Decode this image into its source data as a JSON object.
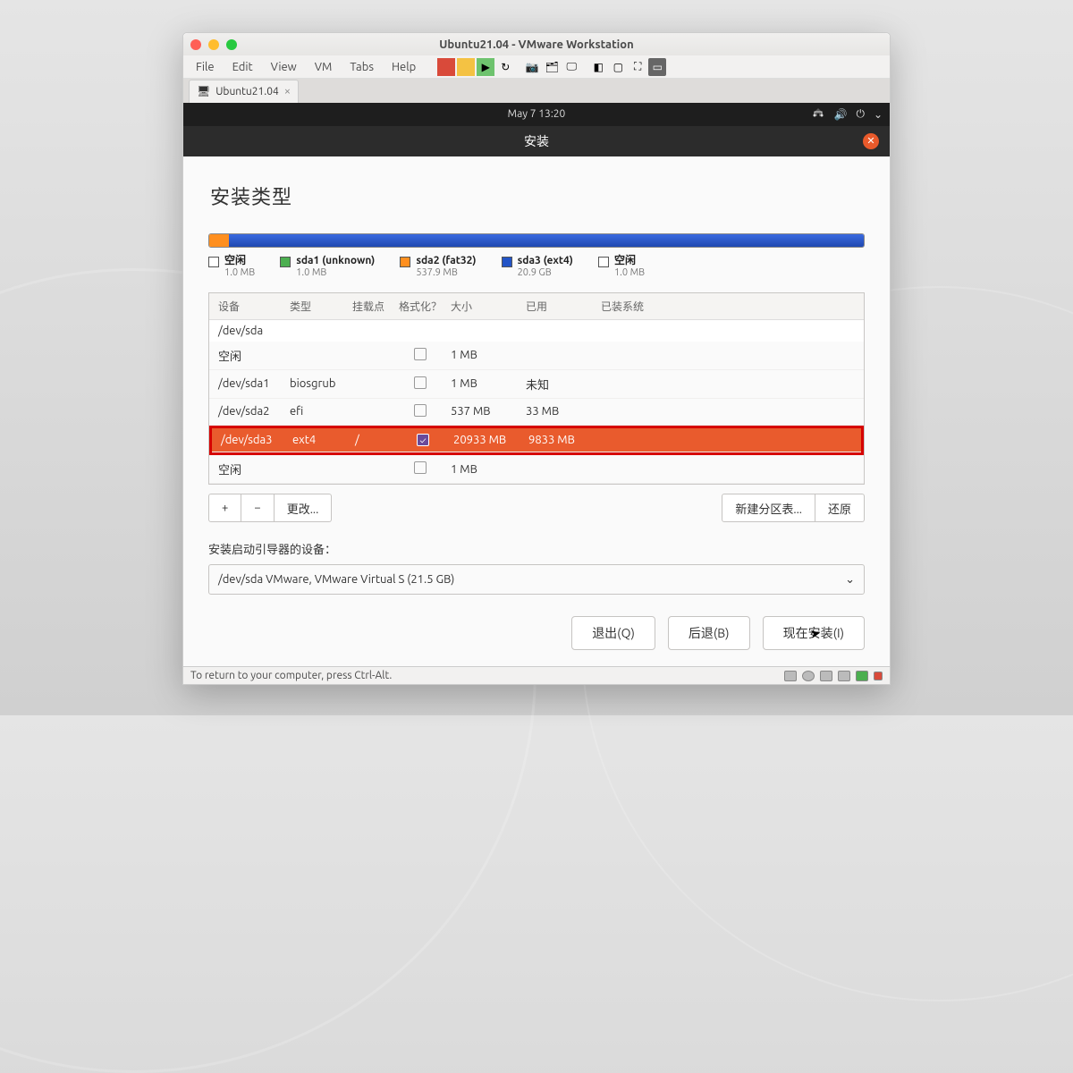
{
  "vm_window": {
    "title": "Ubuntu21.04 - VMware Workstation",
    "menu": [
      "File",
      "Edit",
      "View",
      "VM",
      "Tabs",
      "Help"
    ],
    "tab_label": "Ubuntu21.04",
    "status_hint": "To return to your computer, press Ctrl-Alt."
  },
  "toolbar_icons": [
    "power-icon",
    "pause-icon",
    "play-icon",
    "cycle-icon",
    "snapshot-icon",
    "snapmgr-icon",
    "screen-icon",
    "unity-icon",
    "thumb-icon",
    "fullscreen-icon",
    "fullguest-icon"
  ],
  "gnome": {
    "clock": "May 7  13:20"
  },
  "installer": {
    "title": "安装",
    "section_title": "安装类型",
    "legend": [
      {
        "label": "空闲",
        "sub": "1.0 MB",
        "color": "#ffffff"
      },
      {
        "label": "sda1 (unknown)",
        "sub": "1.0 MB",
        "color": "#4caf50"
      },
      {
        "label": "sda2 (fat32)",
        "sub": "537.9 MB",
        "color": "#ff8f1f"
      },
      {
        "label": "sda3 (ext4)",
        "sub": "20.9 GB",
        "color": "#2354c6"
      },
      {
        "label": "空闲",
        "sub": "1.0 MB",
        "color": "#ffffff"
      }
    ],
    "segments": [
      {
        "color": "#ff8f1f",
        "pct": 3
      },
      {
        "color": "#2354c6",
        "pct": 97
      }
    ],
    "columns": {
      "device": "设备",
      "type": "类型",
      "mount": "挂载点",
      "format": "格式化？",
      "size": "大小",
      "used": "已用",
      "system": "已装系统"
    },
    "group_row": "/dev/sda",
    "rows": [
      {
        "device": "空闲",
        "type": "",
        "mount": "",
        "format": false,
        "size": "1 MB",
        "used": "",
        "selected": false
      },
      {
        "device": "/dev/sda1",
        "type": "biosgrub",
        "mount": "",
        "format": false,
        "size": "1 MB",
        "used": "未知",
        "selected": false
      },
      {
        "device": "/dev/sda2",
        "type": "efi",
        "mount": "",
        "format": false,
        "size": "537 MB",
        "used": "33 MB",
        "selected": false
      },
      {
        "device": "/dev/sda3",
        "type": "ext4",
        "mount": "/",
        "format": true,
        "size": "20933 MB",
        "used": "9833 MB",
        "selected": true
      },
      {
        "device": "空闲",
        "type": "",
        "mount": "",
        "format": false,
        "size": "1 MB",
        "used": "",
        "selected": false
      }
    ],
    "buttons": {
      "add": "+",
      "remove": "−",
      "change": "更改...",
      "new_table": "新建分区表...",
      "revert": "还原"
    },
    "bootloader_label": "安装启动引导器的设备：",
    "bootloader_value": "/dev/sda   VMware, VMware Virtual S (21.5 GB)",
    "actions": {
      "quit": "退出(Q)",
      "back": "后退(B)",
      "install": "现在安装(I)"
    }
  }
}
